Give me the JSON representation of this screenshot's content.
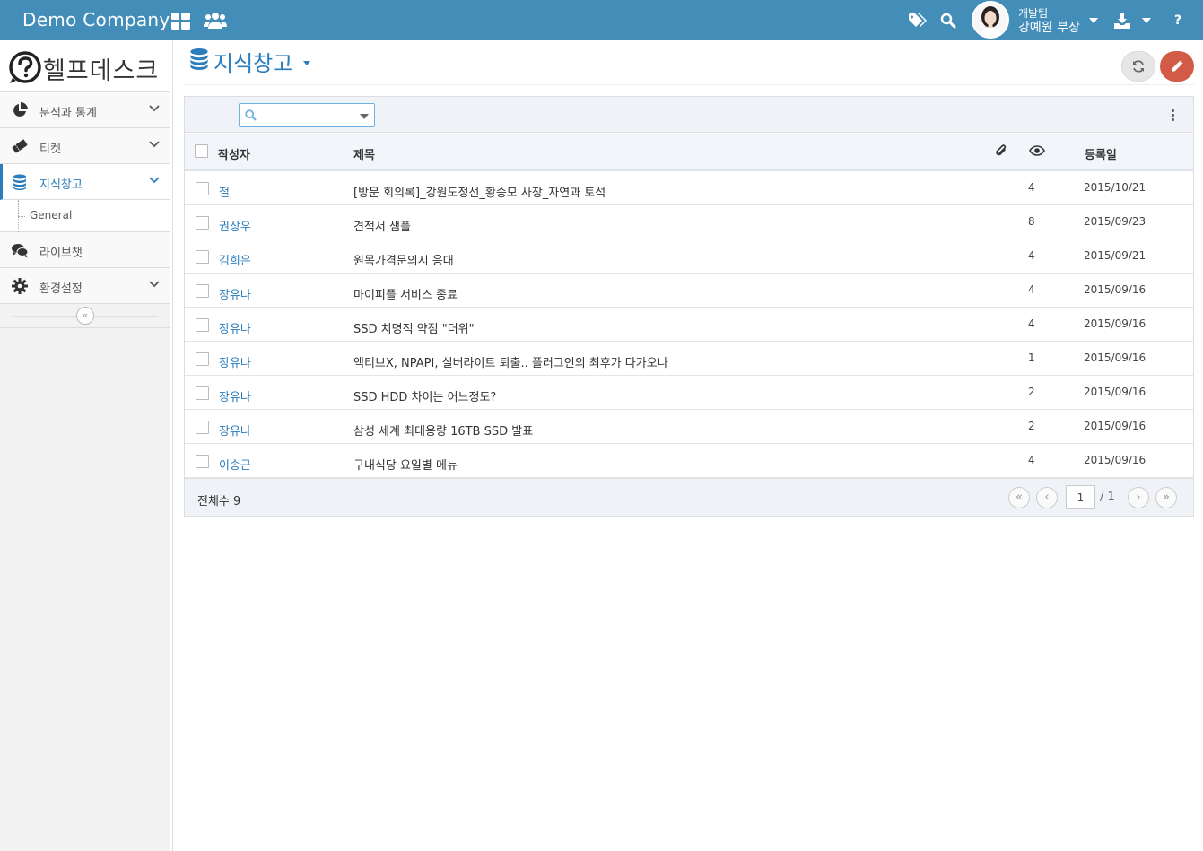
{
  "app": {
    "company": "Demo Company",
    "user": {
      "department": "개발팀",
      "name": "강예원 부장"
    },
    "brand_color": "#438eb9",
    "accent_color": "#2b7dbc",
    "danger_color": "#d15b47"
  },
  "sidebar": {
    "logo_text": "헬프데스크",
    "items": [
      {
        "label": "분석과 통계",
        "icon": "pie-chart-icon",
        "expandable": true
      },
      {
        "label": "티켓",
        "icon": "ticket-icon",
        "expandable": true
      },
      {
        "label": "지식창고",
        "icon": "database-icon",
        "expandable": true,
        "active": true
      },
      {
        "label": "라이브챗",
        "icon": "comments-icon",
        "expandable": false
      },
      {
        "label": "환경설정",
        "icon": "gear-icon",
        "expandable": true
      }
    ],
    "subitem": "General",
    "collapse_label": "«"
  },
  "page": {
    "title": "지식창고"
  },
  "search": {
    "value": "",
    "placeholder": ""
  },
  "table": {
    "headers": {
      "author": "작성자",
      "title": "제목",
      "date": "등록일"
    },
    "rows": [
      {
        "author": "철",
        "title": "[방문 회의록]_강원도정선_황승모 사장_자연과 토석",
        "views": "4",
        "date": "2015/10/21"
      },
      {
        "author": "권상우",
        "title": "견적서 샘플",
        "views": "8",
        "date": "2015/09/23"
      },
      {
        "author": "김희은",
        "title": "원목가격문의시 응대",
        "views": "4",
        "date": "2015/09/21"
      },
      {
        "author": "장유나",
        "title": "마이피플 서비스 종료",
        "views": "4",
        "date": "2015/09/16"
      },
      {
        "author": "장유나",
        "title": "SSD 치명적 약점 \"더위\"",
        "views": "4",
        "date": "2015/09/16"
      },
      {
        "author": "장유나",
        "title": "액티브X, NPAPI, 실버라이트 퇴출.. 플러그인의 최후가 다가오나",
        "views": "1",
        "date": "2015/09/16"
      },
      {
        "author": "장유나",
        "title": "SSD HDD 차이는 어느정도?",
        "views": "2",
        "date": "2015/09/16"
      },
      {
        "author": "장유나",
        "title": "삼성 세계 최대용량 16TB SSD 발표",
        "views": "2",
        "date": "2015/09/16"
      },
      {
        "author": "이송근",
        "title": "구내식당 요일별 메뉴",
        "views": "4",
        "date": "2015/09/16"
      }
    ],
    "total": "전체수 9"
  },
  "pager": {
    "current": "1",
    "of": "/ 1",
    "first": "«",
    "prev": "‹",
    "next": "›",
    "last": "»"
  }
}
